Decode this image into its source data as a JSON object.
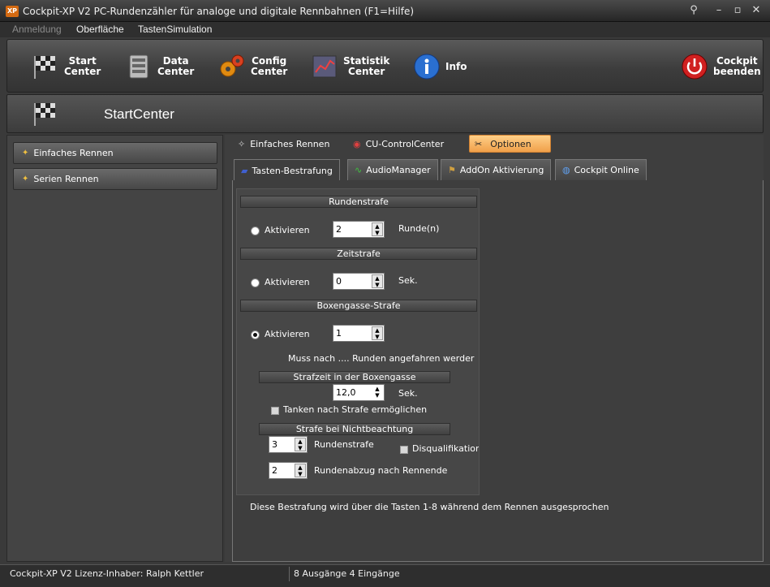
{
  "window": {
    "title": "Cockpit-XP V2 PC-Rundenzähler für analoge und digitale Rennbahnen (F1=Hilfe)",
    "app_icon_text": "XP"
  },
  "menu": {
    "items": [
      "Anmeldung",
      "Oberfläche",
      "TastenSimulation"
    ]
  },
  "toolbar": {
    "start": "Start\nCenter",
    "data": "Data\nCenter",
    "config": "Config\nCenter",
    "statistik": "Statistik\nCenter",
    "info": "Info",
    "beenden": "Cockpit\nbeenden"
  },
  "section": {
    "title": "StartCenter"
  },
  "sidebar": {
    "items": [
      "Einfaches Rennen",
      "Serien Rennen"
    ]
  },
  "top_tabs": [
    "Einfaches Rennen",
    "CU-ControlCenter",
    "Optionen"
  ],
  "sub_tabs": [
    "Tasten-Bestrafung",
    "AudioManager",
    "AddOn Aktivierung",
    "Cockpit Online"
  ],
  "rundenstrafe": {
    "header": "Rundenstrafe",
    "radio_label": "Aktivieren",
    "value": "2",
    "unit": "Runde(n)"
  },
  "zeitstrafe": {
    "header": "Zeitstrafe",
    "radio_label": "Aktivieren",
    "value": "0",
    "unit": "Sek."
  },
  "boxengasse": {
    "header": "Boxengasse-Strafe",
    "radio_label": "Aktivieren",
    "value": "1",
    "note": "Muss nach .... Runden angefahren werder",
    "strafzeit_header": "Strafzeit in der Boxengasse",
    "strafzeit_value": "12,0",
    "strafzeit_unit": "Sek.",
    "tanken_label": "Tanken nach Strafe ermöglichen",
    "nichtbeachtung_header": "Strafe bei Nichtbeachtung",
    "rundenstrafe_value": "3",
    "rundenstrafe_label": "Rundenstrafe",
    "disq_label": "Disqualifikation",
    "abzug_value": "2",
    "abzug_label": "Rundenabzug nach Rennende"
  },
  "footer_note": "Diese Bestrafung wird über die Tasten 1-8 während dem Rennen ausgesprochen",
  "status": {
    "left": "Cockpit-XP V2 Lizenz-Inhaber: Ralph Kettler",
    "right": "8 Ausgänge 4 Eingänge"
  },
  "colors": {
    "accent_tab": "#f0a04a",
    "background": "#3a3a3a",
    "power_red": "#d02020"
  }
}
